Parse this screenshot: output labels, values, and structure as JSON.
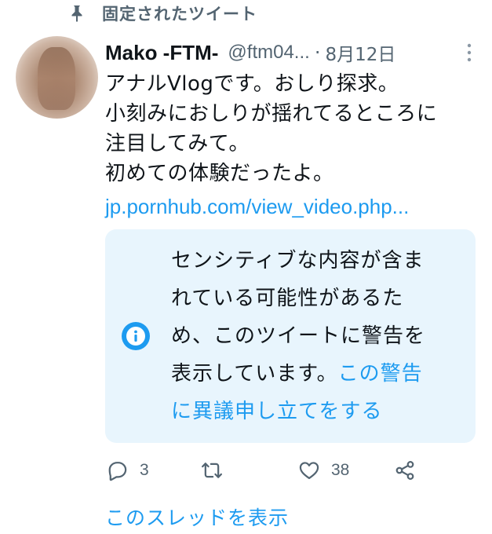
{
  "pinned": {
    "label": "固定されたツイート",
    "icon": "pin-icon"
  },
  "tweet": {
    "author_name": "Mako -FTM-",
    "handle": "@ftm04...",
    "separator": "·",
    "date": "8月12日",
    "body_lines": [
      "アナルVlogです。おしり探求。",
      "小刻みにおしりが揺れてるところに",
      "注目してみて。",
      "初めての体験だったよ。"
    ],
    "link": "jp.pornhub.com/view_video.php..."
  },
  "warning": {
    "lines": [
      "センシティブな内容が含ま",
      "れている可能性があるた",
      "め、このツイートに警告を"
    ],
    "line4_text": "表示しています。",
    "appeal_part1": "この警告",
    "appeal_part2": "に異議申し立てをする",
    "icon": "info-icon"
  },
  "actions": {
    "replies": "3",
    "retweets": "",
    "likes": "38"
  },
  "show_thread": "このスレッドを表示",
  "colors": {
    "accent": "#1d9bf0",
    "muted": "#536471",
    "warning_bg": "#e8f5fd"
  }
}
